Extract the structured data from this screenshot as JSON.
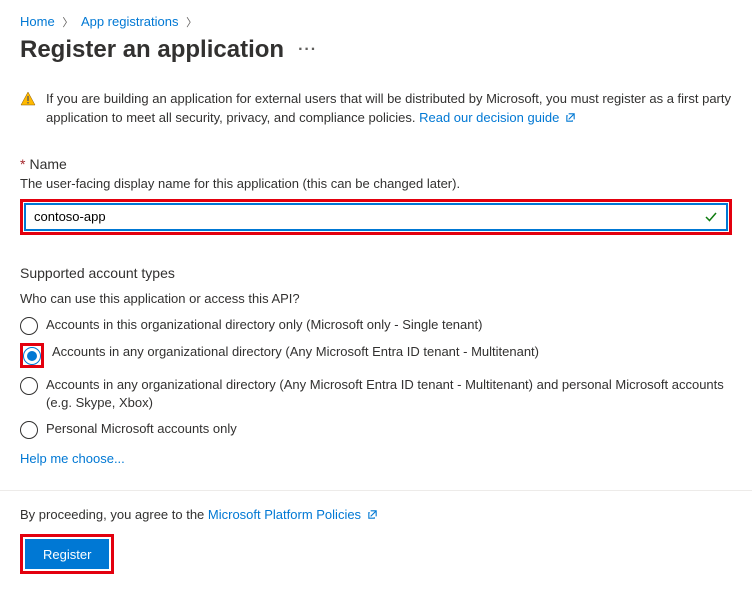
{
  "breadcrumb": {
    "home": "Home",
    "app_reg": "App registrations"
  },
  "page_title": "Register an application",
  "warning": {
    "text": "If you are building an application for external users that will be distributed by Microsoft, you must register as a first party application to meet all security, privacy, and compliance policies. ",
    "link": "Read our decision guide"
  },
  "name_field": {
    "label": "Name",
    "help": "The user-facing display name for this application (this can be changed later).",
    "value": "contoso-app"
  },
  "account_types": {
    "title": "Supported account types",
    "question": "Who can use this application or access this API?",
    "options": [
      "Accounts in this organizational directory only (Microsoft only - Single tenant)",
      "Accounts in any organizational directory (Any Microsoft Entra ID tenant - Multitenant)",
      "Accounts in any organizational directory (Any Microsoft Entra ID tenant - Multitenant) and personal Microsoft accounts (e.g. Skype, Xbox)",
      "Personal Microsoft accounts only"
    ],
    "help_link": "Help me choose..."
  },
  "consent": {
    "text": "By proceeding, you agree to the ",
    "link": "Microsoft Platform Policies"
  },
  "register_label": "Register"
}
